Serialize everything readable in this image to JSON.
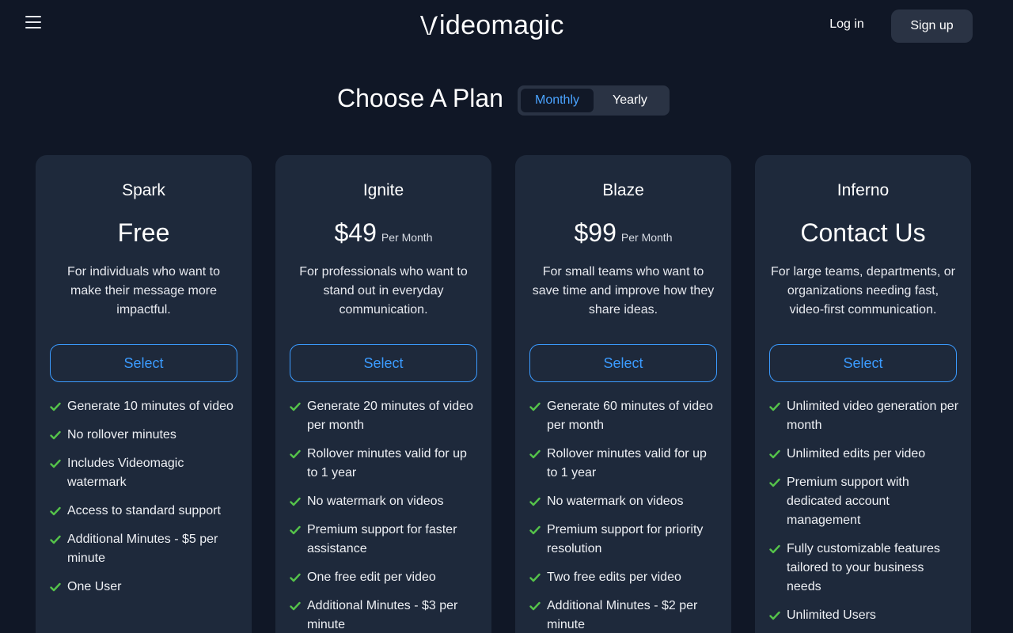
{
  "header": {
    "logo_text": "ideomagic",
    "login_label": "Log in",
    "signup_label": "Sign up"
  },
  "title": "Choose A Plan",
  "billing_toggle": {
    "options": [
      "Monthly",
      "Yearly"
    ],
    "selected": "Monthly"
  },
  "colors": {
    "accent": "#3b9bff",
    "check": "#55c34a",
    "card_bg": "#1e293b",
    "page_bg": "#101726"
  },
  "plans": [
    {
      "name": "Spark",
      "price": "Free",
      "per": "",
      "description": "For individuals who want to make their message more impactful.",
      "select_label": "Select",
      "features": [
        "Generate 10 minutes of video",
        "No rollover minutes",
        "Includes Videomagic watermark",
        "Access to standard support",
        "Additional Minutes - $5 per minute",
        "One User"
      ]
    },
    {
      "name": "Ignite",
      "price": "$49",
      "per": "Per Month",
      "description": "For professionals who want to stand out in everyday communication.",
      "select_label": "Select",
      "features": [
        "Generate 20 minutes of video per month",
        "Rollover minutes valid for up to 1 year",
        "No watermark on videos",
        "Premium support for faster assistance",
        "One free edit per video",
        "Additional Minutes - $3 per minute"
      ]
    },
    {
      "name": "Blaze",
      "price": "$99",
      "per": "Per Month",
      "description": "For small teams who want to save time and improve how they share ideas.",
      "select_label": "Select",
      "features": [
        "Generate 60 minutes of video per month",
        "Rollover minutes valid for up to 1 year",
        "No watermark on videos",
        "Premium support for priority resolution",
        "Two free edits per video",
        "Additional Minutes - $2 per minute"
      ]
    },
    {
      "name": "Inferno",
      "price": "Contact Us",
      "per": "",
      "description": "For large teams, departments, or organizations needing fast, video-first communication.",
      "select_label": "Select",
      "features": [
        "Unlimited video generation per month",
        "Unlimited edits per video",
        "Premium support with dedicated account management",
        "Fully customizable features tailored to your business needs",
        "Unlimited Users"
      ]
    }
  ]
}
